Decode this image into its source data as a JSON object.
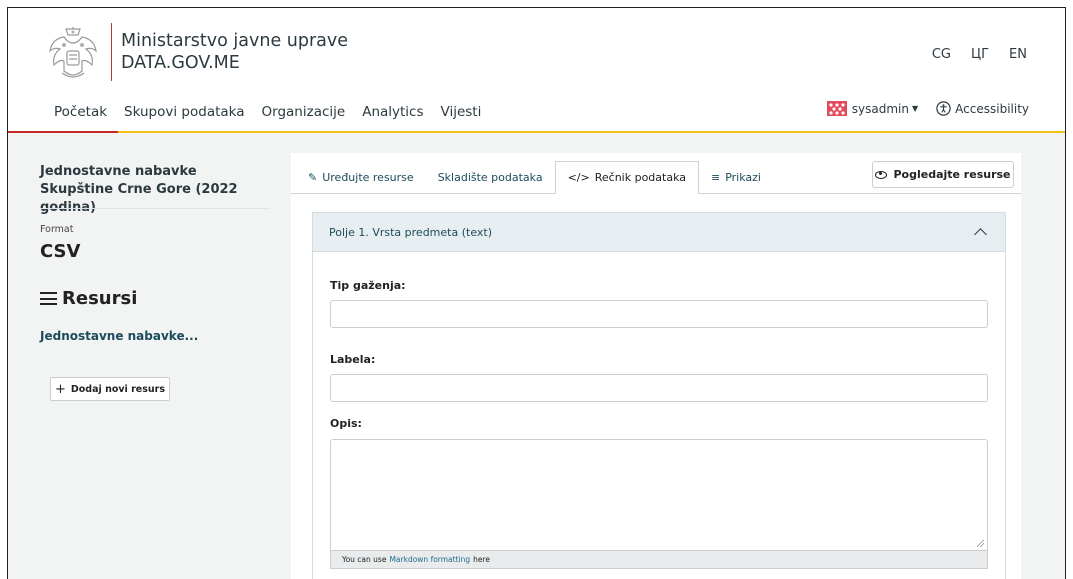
{
  "header": {
    "ministry": "Ministarstvo javne uprave",
    "site": "DATA.GOV.ME",
    "languages": [
      "CG",
      "ЦГ",
      "EN"
    ]
  },
  "nav": {
    "items": [
      "Početak",
      "Skupovi podataka",
      "Organizacije",
      "Analytics",
      "Vijesti"
    ]
  },
  "user": {
    "name": "sysadmin",
    "accessibility": "Accessibility"
  },
  "sidebar": {
    "dataset_title": "Jednostavne nabavke Skupštine Crne Gore (2022 godina)",
    "format_label": "Format",
    "format_value": "CSV",
    "resources_heading": "Resursi",
    "resource_item": "Jednostavne nabavke...",
    "add_resource": "Dodaj novi resurs"
  },
  "tabs": [
    {
      "label": "Uređujte resurse",
      "icon": "pencil-icon"
    },
    {
      "label": "Skladište podataka",
      "icon": ""
    },
    {
      "label": "Rečnik podataka",
      "icon": "code-icon"
    },
    {
      "label": "Prikazi",
      "icon": "chart-icon"
    }
  ],
  "active_tab": "Rečnik podataka",
  "view_resource": "Pogledajte resurse",
  "panel": {
    "title": "Polje 1. Vrsta predmeta (text)",
    "type_label": "Tip gaženja:",
    "type_value": "",
    "label_label": "Labela:",
    "label_value": "",
    "desc_label": "Opis:",
    "desc_value": "",
    "markdown_prefix": "You can use",
    "markdown_link": "Markdown formatting",
    "markdown_suffix": "here"
  },
  "colors": {
    "accent_red": "#c62828",
    "accent_yellow": "#f0c419",
    "link": "#1c4b5c",
    "panel_head": "#e7eef1"
  }
}
